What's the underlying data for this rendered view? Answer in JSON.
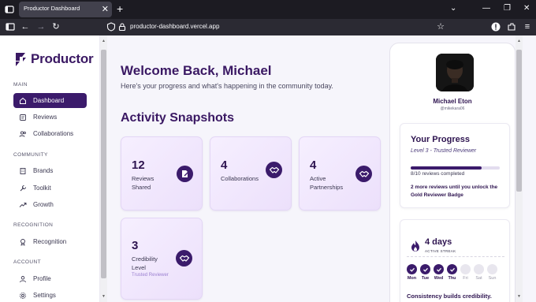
{
  "browser": {
    "tab_title": "Productor Dashboard",
    "url": "productor-dashboard.vercel.app"
  },
  "sidebar": {
    "logo_text": "Productor",
    "sections": [
      {
        "label": "MAIN",
        "items": [
          {
            "label": "Dashboard",
            "icon": "home-icon",
            "active": true
          },
          {
            "label": "Reviews",
            "icon": "reviews-icon"
          },
          {
            "label": "Collaborations",
            "icon": "users-icon"
          }
        ]
      },
      {
        "label": "COMMUNITY",
        "items": [
          {
            "label": "Brands",
            "icon": "building-icon"
          },
          {
            "label": "Toolkit",
            "icon": "wrench-icon"
          },
          {
            "label": "Growth",
            "icon": "trend-up-icon"
          }
        ]
      },
      {
        "label": "RECOGNITION",
        "items": [
          {
            "label": "Recognition",
            "icon": "award-icon"
          }
        ]
      },
      {
        "label": "ACCOUNT",
        "items": [
          {
            "label": "Profile",
            "icon": "user-icon"
          },
          {
            "label": "Settings",
            "icon": "gear-icon"
          }
        ]
      }
    ]
  },
  "main": {
    "welcome": "Welcome Back, Michael",
    "subtitle": "Here's your progress and what's happening in the community today.",
    "snapshots_title": "Activity Snapshots",
    "cards": [
      {
        "value": "12",
        "label": "Reviews Shared",
        "icon": "edit-doc-icon"
      },
      {
        "value": "4",
        "label": "Collaborations",
        "icon": "handshake-icon"
      },
      {
        "value": "4",
        "label": "Active Partnerships",
        "icon": "handshake-icon"
      },
      {
        "value": "3",
        "label": "Credibility Level",
        "sub": "Trusted Reviewer",
        "icon": "handshake-icon"
      }
    ]
  },
  "profile": {
    "name": "Michael Eton",
    "handle": "@mikekara06",
    "progress": {
      "title": "Your Progress",
      "level": "Level 3 - Trusted Reviewer",
      "completed_text": "8/10 reviews completed",
      "completed": 8,
      "total": 10,
      "next_text": "2 more reviews until you unlock the Gold Reviewer Badge"
    },
    "streak": {
      "days_text": "4 days",
      "label": "ACTIVE STREAK",
      "days": [
        {
          "label": "Mon",
          "done": true
        },
        {
          "label": "Tue",
          "done": true
        },
        {
          "label": "Wed",
          "done": true
        },
        {
          "label": "Thu",
          "done": true
        },
        {
          "label": "Fri",
          "done": false
        },
        {
          "label": "Sat",
          "done": false
        },
        {
          "label": "Sun",
          "done": false
        }
      ],
      "footer": "Consistency builds credibility."
    }
  },
  "colors": {
    "brand": "#3b1b6b",
    "card_bg": "#f1e7fd"
  }
}
